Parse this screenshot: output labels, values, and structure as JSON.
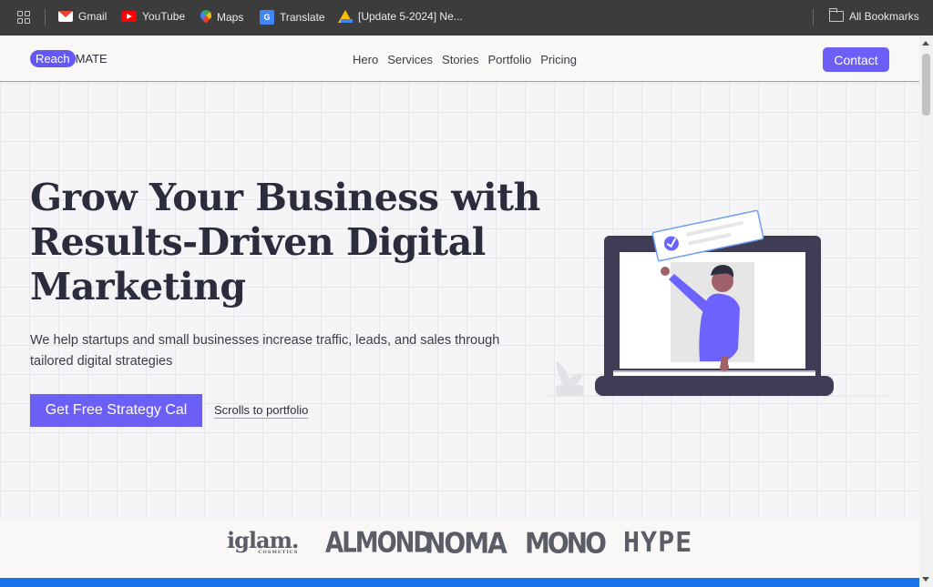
{
  "bookmarks": {
    "items": [
      {
        "label": "Gmail",
        "icon": "gmail-icon"
      },
      {
        "label": "YouTube",
        "icon": "youtube-icon"
      },
      {
        "label": "Maps",
        "icon": "maps-icon"
      },
      {
        "label": "Translate",
        "icon": "translate-icon"
      },
      {
        "label": "[Update 5-2024] Ne...",
        "icon": "drive-icon"
      }
    ],
    "all_bookmarks": "All Bookmarks"
  },
  "nav": {
    "logo_pill": "Reach",
    "logo_text": "MATE",
    "links": [
      "Hero",
      "Services",
      "Stories",
      "Portfolio",
      "Pricing"
    ],
    "contact": "Contact"
  },
  "hero": {
    "title": "Grow Your Business with Results-Driven Digital Marketing",
    "subtitle": "We help startups and small businesses increase traffic, leads, and sales through tailored digital strategies",
    "cta": "Get Free Strategy Cal",
    "scroll_link": "Scrolls to portfolio"
  },
  "logos": {
    "brands": [
      "iglam.",
      "ALMOND",
      "NOMA",
      "MONO",
      "HYPE"
    ],
    "iglam_tagline": "COSMETICS"
  },
  "colors": {
    "accent": "#6c5ff6",
    "text_dark": "#2b2d3c",
    "illustration_purple": "#6c63ff",
    "laptop": "#3f3d56"
  }
}
